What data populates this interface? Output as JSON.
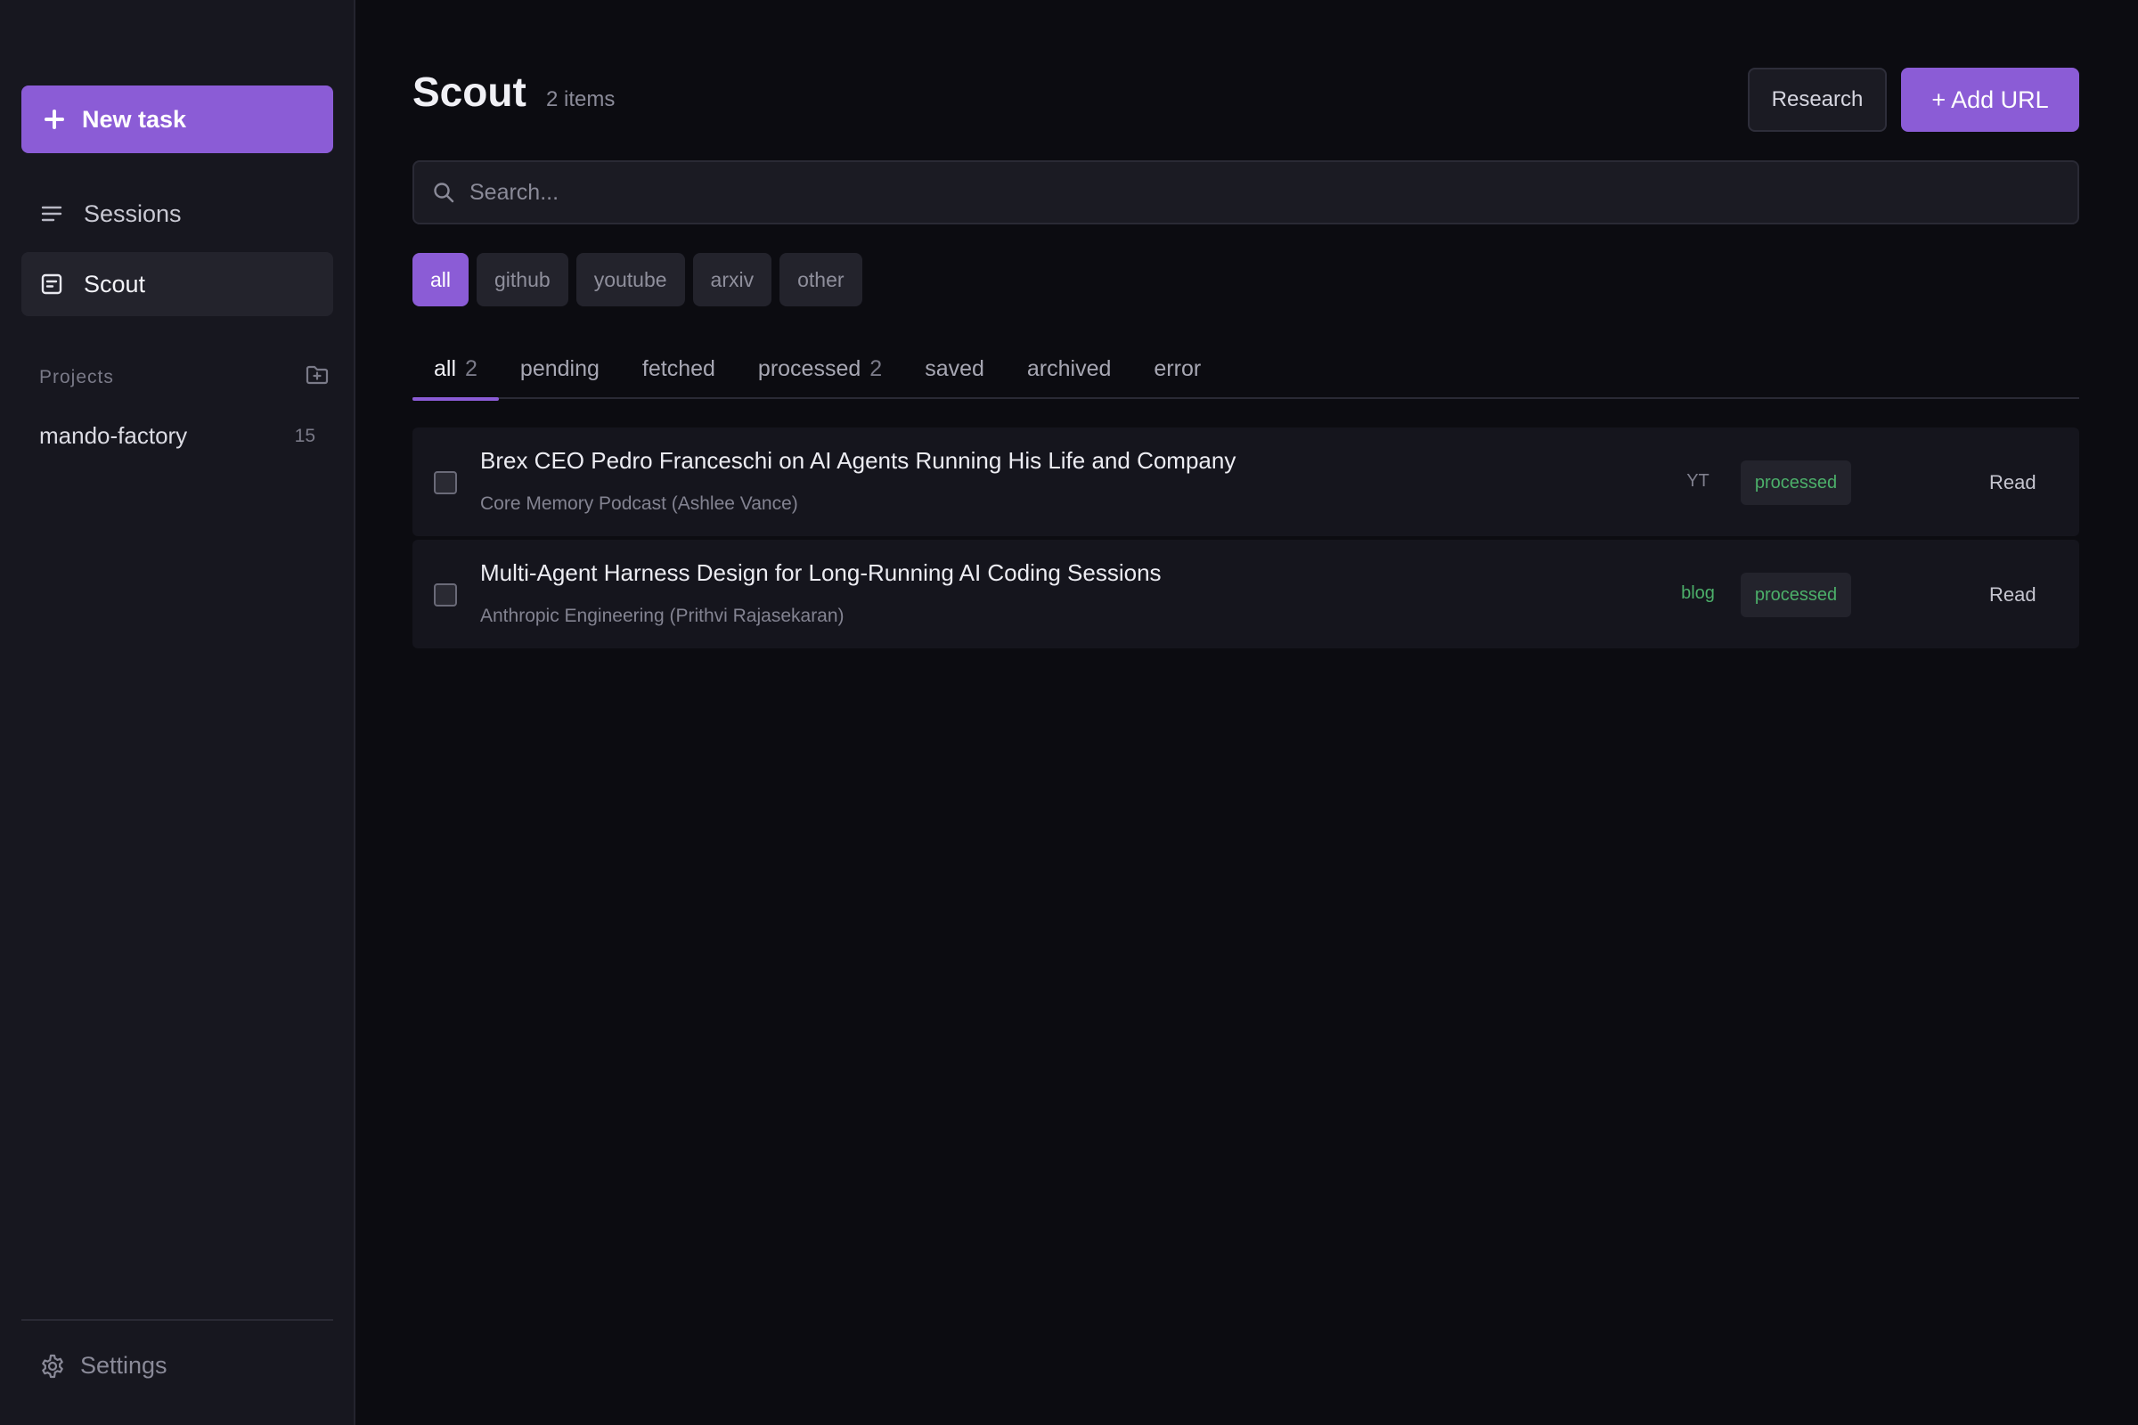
{
  "sidebar": {
    "new_task_label": "New task",
    "nav": [
      {
        "label": "Sessions",
        "icon": "menu-lines-icon"
      },
      {
        "label": "Scout",
        "icon": "document-icon"
      }
    ],
    "projects_heading": "Projects",
    "projects": [
      {
        "name": "mando-factory",
        "count": "15"
      }
    ],
    "settings_label": "Settings"
  },
  "header": {
    "title": "Scout",
    "item_count": "2 items",
    "research_label": "Research",
    "add_url_label": "+ Add URL"
  },
  "search": {
    "placeholder": "Search..."
  },
  "source_filters": [
    "all",
    "github",
    "youtube",
    "arxiv",
    "other"
  ],
  "status_tabs": [
    {
      "label": "all",
      "count": "2"
    },
    {
      "label": "pending",
      "count": ""
    },
    {
      "label": "fetched",
      "count": ""
    },
    {
      "label": "processed",
      "count": "2"
    },
    {
      "label": "saved",
      "count": ""
    },
    {
      "label": "archived",
      "count": ""
    },
    {
      "label": "error",
      "count": ""
    }
  ],
  "items": [
    {
      "title": "Brex CEO Pedro Franceschi on AI Agents Running His Life and Company",
      "source": "Core Memory Podcast (Ashlee Vance)",
      "type": "YT",
      "status": "processed",
      "action": "Read"
    },
    {
      "title": "Multi-Agent Harness Design for Long-Running AI Coding Sessions",
      "source": "Anthropic Engineering (Prithvi Rajasekaran)",
      "type": "blog",
      "status": "processed",
      "action": "Read"
    }
  ],
  "colors": {
    "accent": "#8b5cd6",
    "status_green": "#4caf6a",
    "background": "#0c0c11",
    "sidebar": "#17171f"
  }
}
